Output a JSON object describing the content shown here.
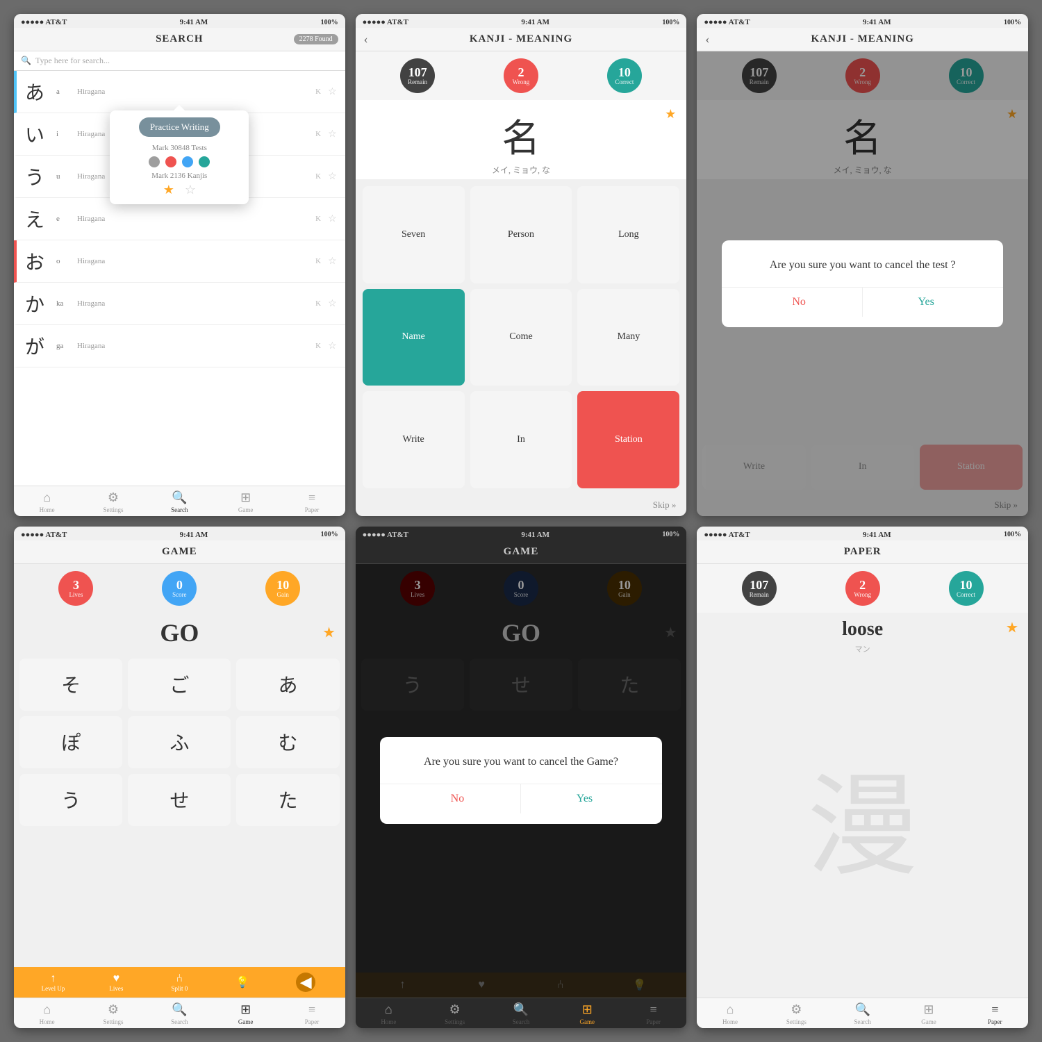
{
  "screens": [
    {
      "id": "search-screen",
      "status": {
        "carrier": "●●●●● AT&T",
        "time": "9:41 AM",
        "battery": "100%"
      },
      "header": {
        "title": "SEARCH",
        "badge": "2278 Found"
      },
      "search": {
        "placeholder": "Type here for search..."
      },
      "popup": {
        "button": "Practice Writing",
        "mark_tests": "Mark 30848 Tests",
        "mark_kanjis": "Mark 2136 Kanjis"
      },
      "list": [
        {
          "kana": "あ",
          "romaji": "a",
          "type": "Hiragana",
          "k": "K",
          "accent": "blue"
        },
        {
          "kana": "い",
          "romaji": "i",
          "type": "Hiragana",
          "k": "K",
          "accent": "none"
        },
        {
          "kana": "う",
          "romaji": "u",
          "type": "Hiragana",
          "k": "K",
          "accent": "none"
        },
        {
          "kana": "え",
          "romaji": "e",
          "type": "Hiragana",
          "k": "K",
          "accent": "none"
        },
        {
          "kana": "お",
          "romaji": "o",
          "type": "Hiragana",
          "k": "K",
          "accent": "red"
        },
        {
          "kana": "か",
          "romaji": "ka",
          "type": "Hiragana",
          "k": "K",
          "accent": "none"
        },
        {
          "kana": "が",
          "romaji": "ga",
          "type": "Hiragana",
          "k": "K",
          "accent": "none"
        }
      ],
      "nav": [
        {
          "icon": "🏠",
          "label": "Home"
        },
        {
          "icon": "⚙",
          "label": "Settings"
        },
        {
          "icon": "🔍",
          "label": "Search",
          "active": true
        },
        {
          "icon": "⊞",
          "label": "Game"
        },
        {
          "icon": "≡",
          "label": "Paper"
        }
      ]
    },
    {
      "id": "kanji-meaning-screen",
      "status": {
        "carrier": "●●●●● AT&T",
        "time": "9:41 AM",
        "battery": "100%"
      },
      "header": {
        "title": "KANJI - MEANING",
        "has_back": true
      },
      "scores": [
        {
          "num": "107",
          "label": "Remain",
          "color": "dark"
        },
        {
          "num": "2",
          "label": "Wrong",
          "color": "red"
        },
        {
          "num": "10",
          "label": "Correct",
          "color": "teal"
        }
      ],
      "kanji": {
        "char": "名",
        "reading": "メイ, ミョウ, な"
      },
      "answers": [
        {
          "text": "Seven",
          "state": "normal"
        },
        {
          "text": "Person",
          "state": "normal"
        },
        {
          "text": "Long",
          "state": "normal"
        },
        {
          "text": "Name",
          "state": "correct"
        },
        {
          "text": "Come",
          "state": "normal"
        },
        {
          "text": "Many",
          "state": "normal"
        },
        {
          "text": "Write",
          "state": "normal"
        },
        {
          "text": "In",
          "state": "normal"
        },
        {
          "text": "Station",
          "state": "wrong"
        }
      ],
      "skip": "Skip »"
    },
    {
      "id": "kanji-meaning-modal-screen",
      "status": {
        "carrier": "●●●●● AT&T",
        "time": "9:41 AM",
        "battery": "100%"
      },
      "header": {
        "title": "KANJI - MEANING",
        "has_back": true
      },
      "scores": [
        {
          "num": "107",
          "label": "Remain",
          "color": "dark"
        },
        {
          "num": "2",
          "label": "Wrong",
          "color": "red"
        },
        {
          "num": "10",
          "label": "Correct",
          "color": "teal"
        }
      ],
      "kanji": {
        "char": "名",
        "reading": "メイ, ミョウ, な"
      },
      "answers": [
        {
          "text": "Write",
          "state": "normal"
        },
        {
          "text": "In",
          "state": "normal"
        },
        {
          "text": "Station",
          "state": "wrong"
        }
      ],
      "modal": {
        "question": "Are you sure you want to cancel the test ?",
        "no": "No",
        "yes": "Yes"
      },
      "skip": "Skip »"
    },
    {
      "id": "game-screen",
      "status": {
        "carrier": "●●●●● AT&T",
        "time": "9:41 AM",
        "battery": "100%"
      },
      "header": {
        "title": "GAME"
      },
      "scores": [
        {
          "num": "3",
          "label": "Lives",
          "color": "red"
        },
        {
          "num": "0",
          "label": "Score",
          "color": "blue"
        },
        {
          "num": "10",
          "label": "Gain",
          "color": "yellow"
        }
      ],
      "word": "GO",
      "hiragana": [
        "そ",
        "ご",
        "あ",
        "ぽ",
        "ふ",
        "む",
        "う",
        "せ",
        "た"
      ],
      "bottom_bar": [
        {
          "icon": "↑",
          "label": "Level Up"
        },
        {
          "icon": "♥",
          "label": "Lives"
        },
        {
          "icon": "Y",
          "label": "Split 0"
        },
        {
          "icon": "💡",
          "label": ""
        }
      ],
      "nav": [
        {
          "icon": "🏠",
          "label": "Home"
        },
        {
          "icon": "⚙",
          "label": "Settings"
        },
        {
          "icon": "🔍",
          "label": "Search"
        },
        {
          "icon": "⊞",
          "label": "Game",
          "active": true
        },
        {
          "icon": "≡",
          "label": "Paper"
        }
      ]
    },
    {
      "id": "game-dark-modal-screen",
      "status": {
        "carrier": "●●●●● AT&T",
        "time": "9:41 AM",
        "battery": "100%"
      },
      "header": {
        "title": "GAME"
      },
      "scores": [
        {
          "num": "3",
          "label": "Lives",
          "color": "darkred"
        },
        {
          "num": "0",
          "label": "Score",
          "color": "darkblue"
        },
        {
          "num": "10",
          "label": "Gain",
          "color": "darkyellow"
        }
      ],
      "word": "GO",
      "hiragana": [
        "う",
        "せ",
        "た"
      ],
      "modal": {
        "question": "Are you sure you want to cancel the Game?",
        "no": "No",
        "yes": "Yes"
      },
      "nav": [
        {
          "icon": "🏠",
          "label": "Home"
        },
        {
          "icon": "⚙",
          "label": "Settings"
        },
        {
          "icon": "🔍",
          "label": "Search"
        },
        {
          "icon": "⊞",
          "label": "Game",
          "active": true
        },
        {
          "icon": "≡",
          "label": "Paper"
        }
      ]
    },
    {
      "id": "paper-screen",
      "status": {
        "carrier": "●●●●● AT&T",
        "time": "9:41 AM",
        "battery": "100%"
      },
      "header": {
        "title": "PAPER"
      },
      "scores": [
        {
          "num": "107",
          "label": "Remain",
          "color": "dark"
        },
        {
          "num": "2",
          "label": "Wrong",
          "color": "red"
        },
        {
          "num": "10",
          "label": "Correct",
          "color": "teal"
        }
      ],
      "word": "loose",
      "reading": "マン",
      "kanji_char": "漫",
      "nav": [
        {
          "icon": "🏠",
          "label": "Home"
        },
        {
          "icon": "⚙",
          "label": "Settings"
        },
        {
          "icon": "🔍",
          "label": "Search"
        },
        {
          "icon": "⊞",
          "label": "Game"
        },
        {
          "icon": "≡",
          "label": "Paper",
          "active": true
        }
      ]
    }
  ],
  "watermark_icon": "🎫"
}
